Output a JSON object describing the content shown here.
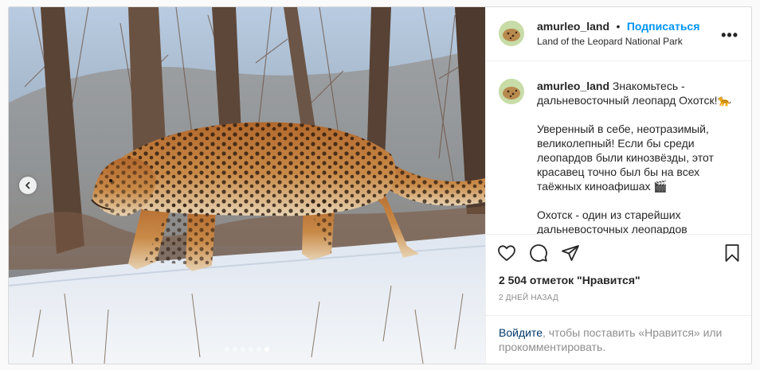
{
  "header": {
    "username": "amurleo_land",
    "separator": "•",
    "follow_label": "Подписаться",
    "location": "Land of the Leopard National Park",
    "more_label": "•••"
  },
  "caption": {
    "username": "amurleo_land",
    "text": " Знакомьтесь - дальневосточный леопард Охотск!🐆\n\nУверенный в себе, неотразимый, великолепный! Если бы среди леопардов были кинозвёзды, этот красавец точно был бы на всех таёжных киноафишах 🎬\n\nОхотск - один из старейших дальневосточных леопардов"
  },
  "icons": {
    "like": "heart-icon",
    "comment": "comment-icon",
    "share": "paper-plane-icon",
    "save": "bookmark-icon",
    "prev": "chevron-left-icon"
  },
  "likes_text": "2 504 отметок \"Нравится\"",
  "date_text": "2 дней назад",
  "login": {
    "link_label": "Войдите",
    "rest_text": ", чтобы поставить «Нравится» или прокомментировать."
  },
  "carousel": {
    "total": 6,
    "active_index": 5
  },
  "colors": {
    "link_blue": "#0095f6",
    "muted": "#8e8e8e",
    "text": "#262626",
    "border": "#dbdbdb"
  }
}
